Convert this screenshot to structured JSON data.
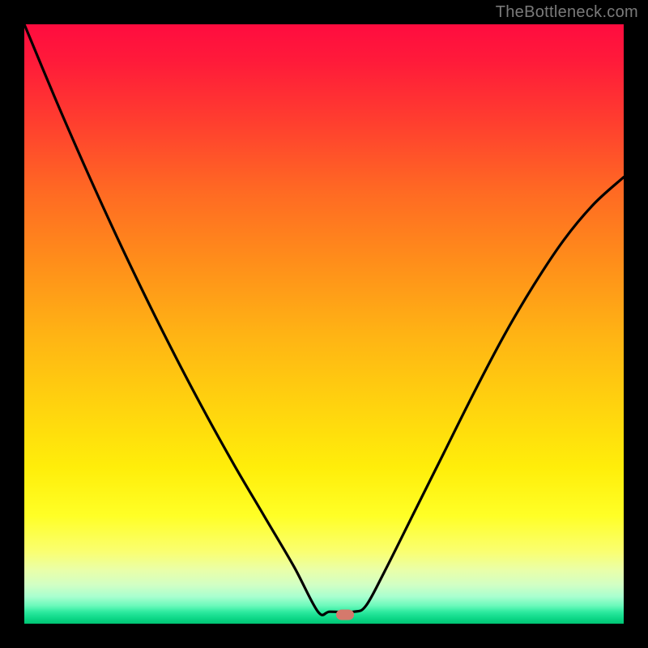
{
  "watermark": "TheBottleneck.com",
  "marker": {
    "x_frac": 0.5351,
    "y_frac": 0.985
  },
  "chart_data": {
    "type": "line",
    "title": "",
    "xlabel": "",
    "ylabel": "",
    "xlim": [
      0,
      1
    ],
    "ylim": [
      0,
      1
    ],
    "series": [
      {
        "name": "bottleneck-curve",
        "x": [
          0.0,
          0.05,
          0.1,
          0.15,
          0.2,
          0.25,
          0.3,
          0.35,
          0.4,
          0.45,
          0.49,
          0.51,
          0.55,
          0.57,
          0.6,
          0.65,
          0.7,
          0.75,
          0.8,
          0.85,
          0.9,
          0.95,
          1.0
        ],
        "y": [
          1.0,
          0.88,
          0.765,
          0.655,
          0.55,
          0.45,
          0.355,
          0.265,
          0.18,
          0.095,
          0.02,
          0.02,
          0.02,
          0.03,
          0.085,
          0.185,
          0.285,
          0.385,
          0.48,
          0.565,
          0.64,
          0.7,
          0.745
        ]
      }
    ],
    "annotations": [
      {
        "name": "optimal-marker",
        "x": 0.535,
        "y": 0.015
      }
    ]
  }
}
